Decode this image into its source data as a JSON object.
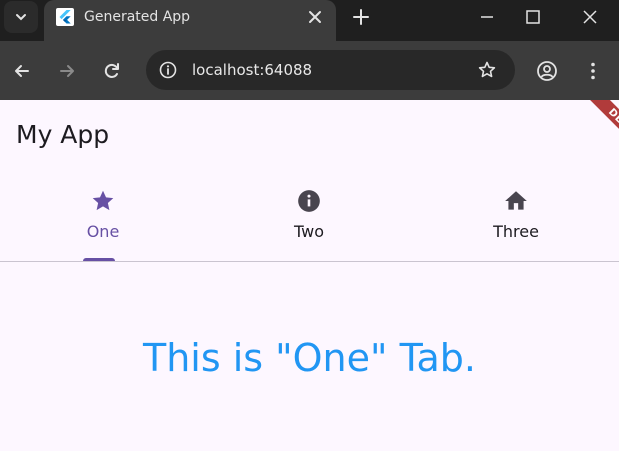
{
  "browser": {
    "tab_title": "Generated App",
    "url": "localhost:64088",
    "icons": {
      "tab_search": "chevron-down-icon",
      "favicon": "flutter-logo",
      "close": "close-icon",
      "new_tab": "plus-icon",
      "minimize": "minimize-icon",
      "maximize": "maximize-icon",
      "close_window": "close-icon",
      "back": "arrow-left-icon",
      "forward": "arrow-right-icon",
      "reload": "reload-icon",
      "site_info": "info-icon",
      "bookmark": "star-outline-icon",
      "profile": "account-icon",
      "menu": "more-vertical-icon"
    }
  },
  "app": {
    "title": "My App",
    "debug_banner": "DEBUG",
    "tabs": [
      {
        "label": "One",
        "icon": "star-icon",
        "selected": true
      },
      {
        "label": "Two",
        "icon": "info-icon",
        "selected": false
      },
      {
        "label": "Three",
        "icon": "home-icon",
        "selected": false
      }
    ],
    "body_text": "This is \"One\" Tab."
  },
  "colors": {
    "app_background": "#fdf7ff",
    "selected_tab": "#6750a4",
    "unselected_tab": "#49454f",
    "body_text": "#2196f3",
    "debug_banner": "#b13b3b",
    "chrome_dark": "#1f1f1f",
    "chrome_toolbar": "#3c3c3c"
  }
}
